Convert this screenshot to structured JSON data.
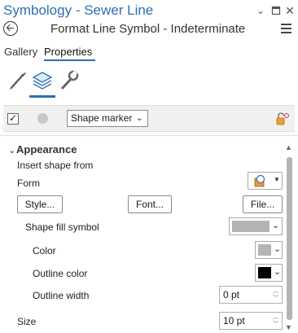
{
  "window": {
    "title": "Symbology - Sewer Line",
    "subtitle": "Format Line Symbol - Indeterminate",
    "controls": [
      "chevron-down-icon",
      "pin-icon",
      "close-icon"
    ]
  },
  "tabs": [
    {
      "label": "Gallery",
      "active": false
    },
    {
      "label": "Properties",
      "active": true
    }
  ],
  "toolbar": {
    "icons": [
      "brush-icon",
      "layers-icon",
      "wrench-icon"
    ],
    "active_index": 1
  },
  "layer_row": {
    "checked": true,
    "marker_type": "Shape marker"
  },
  "appearance": {
    "title": "Appearance",
    "insert_shape_from": "Insert shape from",
    "form_label": "Form",
    "style_button": "Style...",
    "font_button": "Font...",
    "file_button": "File...",
    "shape_fill_label": "Shape fill symbol",
    "shape_fill_color": "#b4b4b4",
    "color_label": "Color",
    "color_value": "#b4b4b4",
    "outline_color_label": "Outline color",
    "outline_color_value": "#000000",
    "outline_width_label": "Outline width",
    "outline_width_value": "0 pt",
    "size_label": "Size",
    "size_value": "10 pt"
  },
  "colors": {
    "accent": "#2d6fb5"
  }
}
